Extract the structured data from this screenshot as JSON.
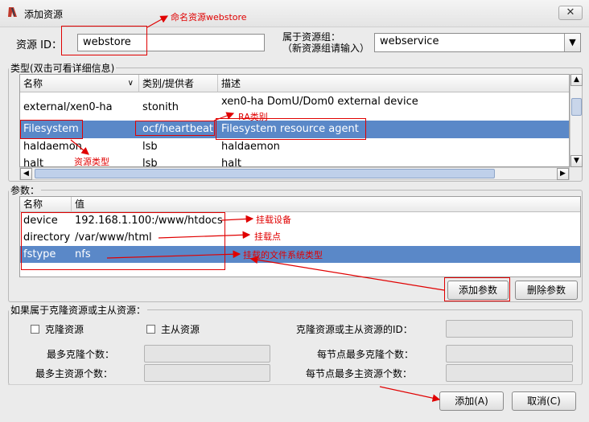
{
  "window": {
    "title": "添加资源",
    "close": "✕"
  },
  "resource_id": {
    "label": "资源 ID：",
    "value": "webstore"
  },
  "group": {
    "label_line1": "属于资源组：",
    "label_line2": "（新资源组请输入）",
    "value": "webservice"
  },
  "type_section": {
    "legend": "类型(双击可看详细信息)",
    "columns": [
      "名称",
      "类别/提供者",
      "描述"
    ],
    "rows": [
      {
        "name": "external/xen0-ha",
        "class": "stonith",
        "desc_line1": "xen0-ha DomU/Dom0 external device",
        "desc_line2": ""
      },
      {
        "name": "Filesystem",
        "class": "ocf/heartbeat",
        "desc_line1": "Filesystem resource agent",
        "selected": true
      },
      {
        "name": "haldaemon",
        "class": "lsb",
        "desc_line1": "haldaemon"
      },
      {
        "name": "halt",
        "class": "lsb",
        "desc_line1": "halt"
      }
    ]
  },
  "params_section": {
    "legend": "参数：",
    "columns": [
      "名称",
      "值"
    ],
    "rows": [
      {
        "name": "device",
        "value": "192.168.1.100:/www/htdocs"
      },
      {
        "name": "directory",
        "value": "/var/www/html"
      },
      {
        "name": "fstype",
        "value": "nfs",
        "selected": true
      }
    ],
    "add_button": "添加参数",
    "delete_button": "删除参数"
  },
  "clone_section": {
    "legend": "如果属于克隆资源或主从资源：",
    "clone_checkbox": "克隆资源",
    "master_checkbox": "主从资源",
    "clone_id_label": "克隆资源或主从资源的ID：",
    "max_clone_label": "最多克隆个数：",
    "max_master_label": "最多主资源个数：",
    "per_node_clone_label": "每节点最多克隆个数：",
    "per_node_master_label": "每节点最多主资源个数："
  },
  "footer": {
    "add_button": "添加(A)",
    "cancel_button": "取消(C)"
  },
  "annotations": {
    "name_resource": "命名资源webstore",
    "ra_class": "RA类别",
    "resource_type": "资源类型",
    "mount_device": "挂载设备",
    "mount_point": "挂载点",
    "fs_type": "挂载的文件系统类型"
  },
  "colors": {
    "selection": "#5a88c8",
    "annotation": "#e00000"
  }
}
